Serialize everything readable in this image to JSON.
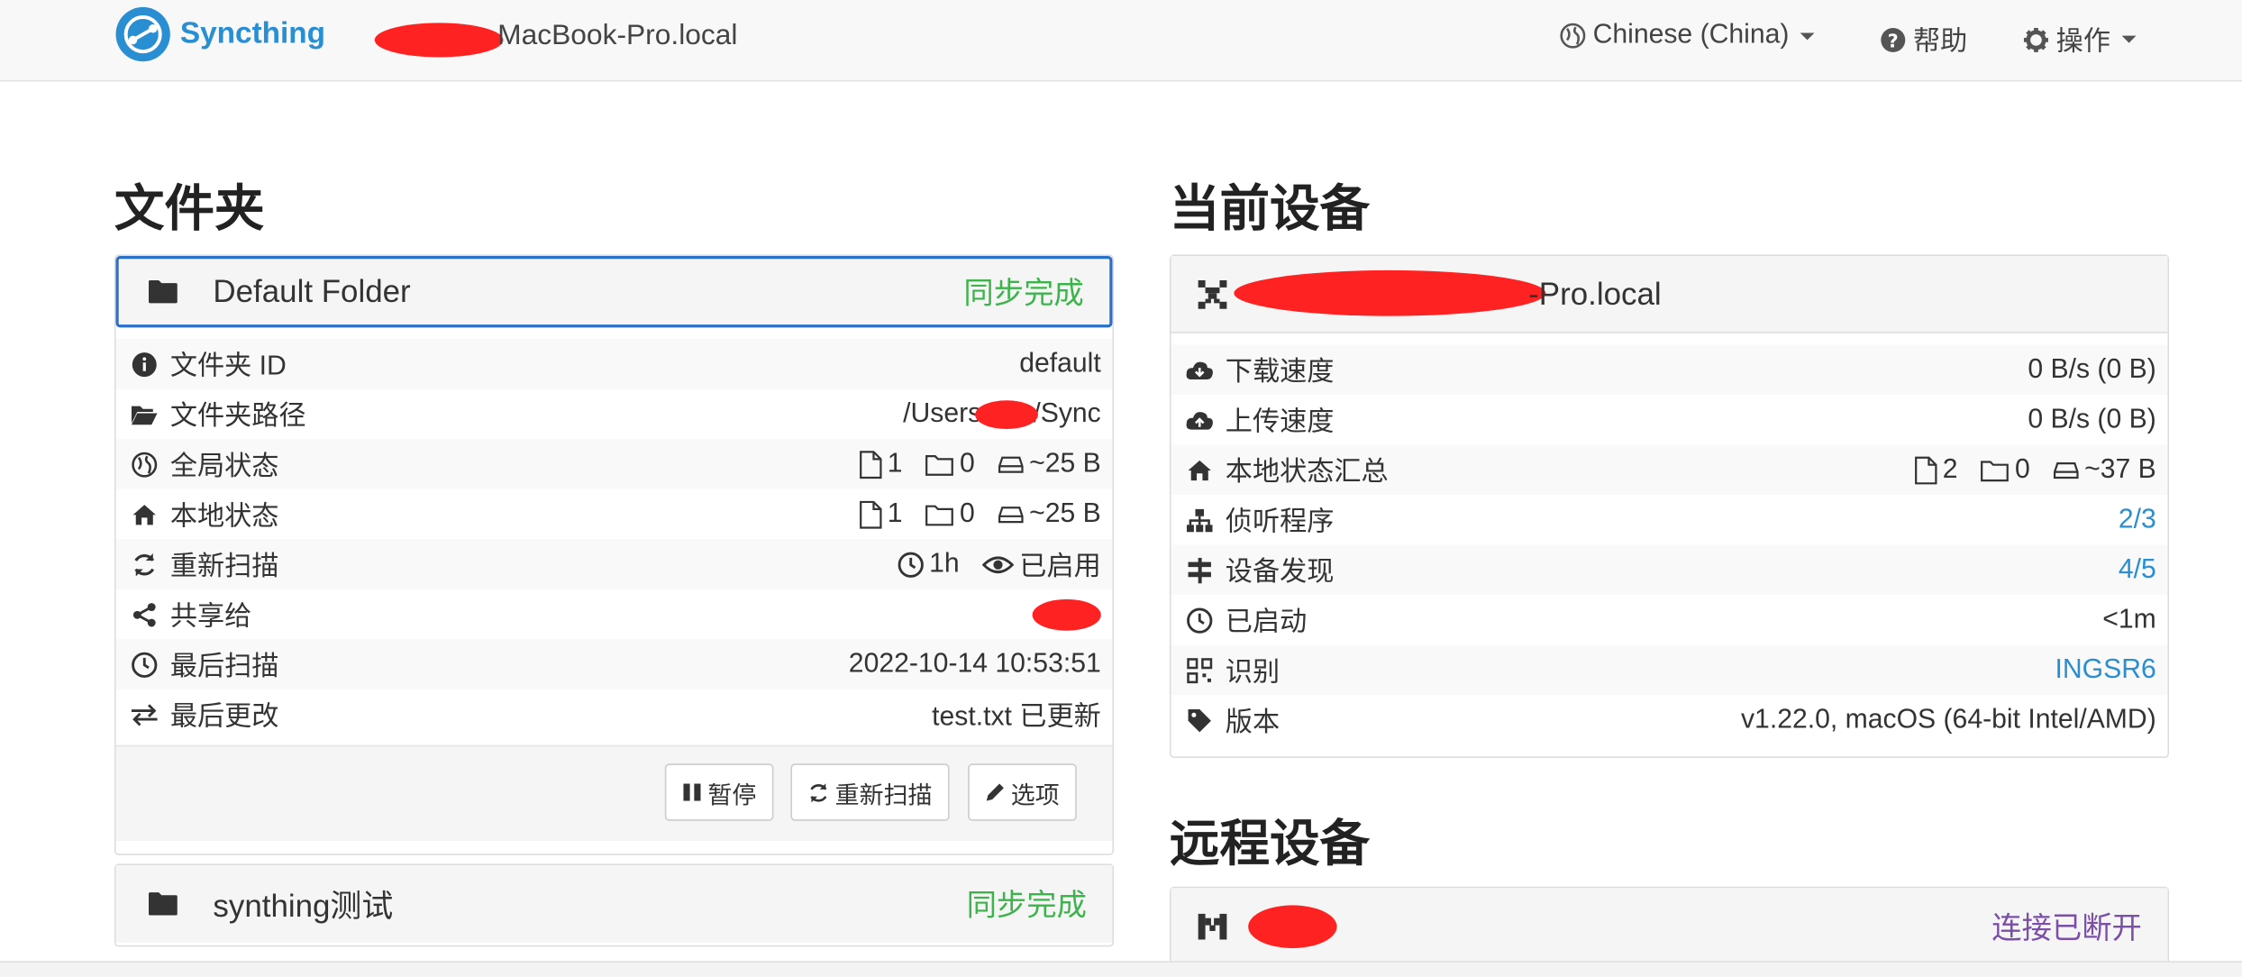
{
  "navbar": {
    "brand": "Syncthing",
    "hostname": "MacBook-Pro.local",
    "language": "Chinese (China)",
    "help": "帮助",
    "actions": "操作"
  },
  "folders": {
    "title": "文件夹",
    "default": {
      "name": "Default Folder",
      "status": "同步完成",
      "rows": [
        {
          "label": "文件夹 ID",
          "value": "default"
        },
        {
          "label": "文件夹路径",
          "value_prefix": "/Users",
          "value_suffix": "/Sync"
        },
        {
          "label": "全局状态",
          "files": "1",
          "dirs": "0",
          "size": "~25 B"
        },
        {
          "label": "本地状态",
          "files": "1",
          "dirs": "0",
          "size": "~25 B"
        },
        {
          "label": "重新扫描",
          "interval": "1h",
          "watcher": "已启用"
        },
        {
          "label": "共享给",
          "value": ""
        },
        {
          "label": "最后扫描",
          "value": "2022-10-14 10:53:51"
        },
        {
          "label": "最后更改",
          "value": "test.txt 已更新"
        }
      ],
      "buttons": {
        "pause": "暂停",
        "rescan": "重新扫描",
        "options": "选项"
      }
    },
    "second": {
      "name": "synthing测试",
      "status": "同步完成"
    }
  },
  "this_device": {
    "title": "当前设备",
    "name": "-Pro.local",
    "rows": [
      {
        "label": "下载速度",
        "value": "0 B/s (0 B)"
      },
      {
        "label": "上传速度",
        "value": "0 B/s (0 B)"
      },
      {
        "label": "本地状态汇总",
        "files": "2",
        "dirs": "0",
        "size": "~37 B"
      },
      {
        "label": "侦听程序",
        "value": "2/3"
      },
      {
        "label": "设备发现",
        "value": "4/5"
      },
      {
        "label": "已启动",
        "value": "<1m"
      },
      {
        "label": "识别",
        "value": "INGSR6"
      },
      {
        "label": "版本",
        "value": "v1.22.0, macOS (64-bit Intel/AMD)"
      }
    ]
  },
  "remote_devices": {
    "title": "远程设备",
    "first": {
      "status": "连接已断开"
    }
  },
  "colors": {
    "brand": "#2a8ed3",
    "ok": "#3cb44b",
    "disconnected": "#7b4fa8",
    "redaction": "#ff2222"
  }
}
